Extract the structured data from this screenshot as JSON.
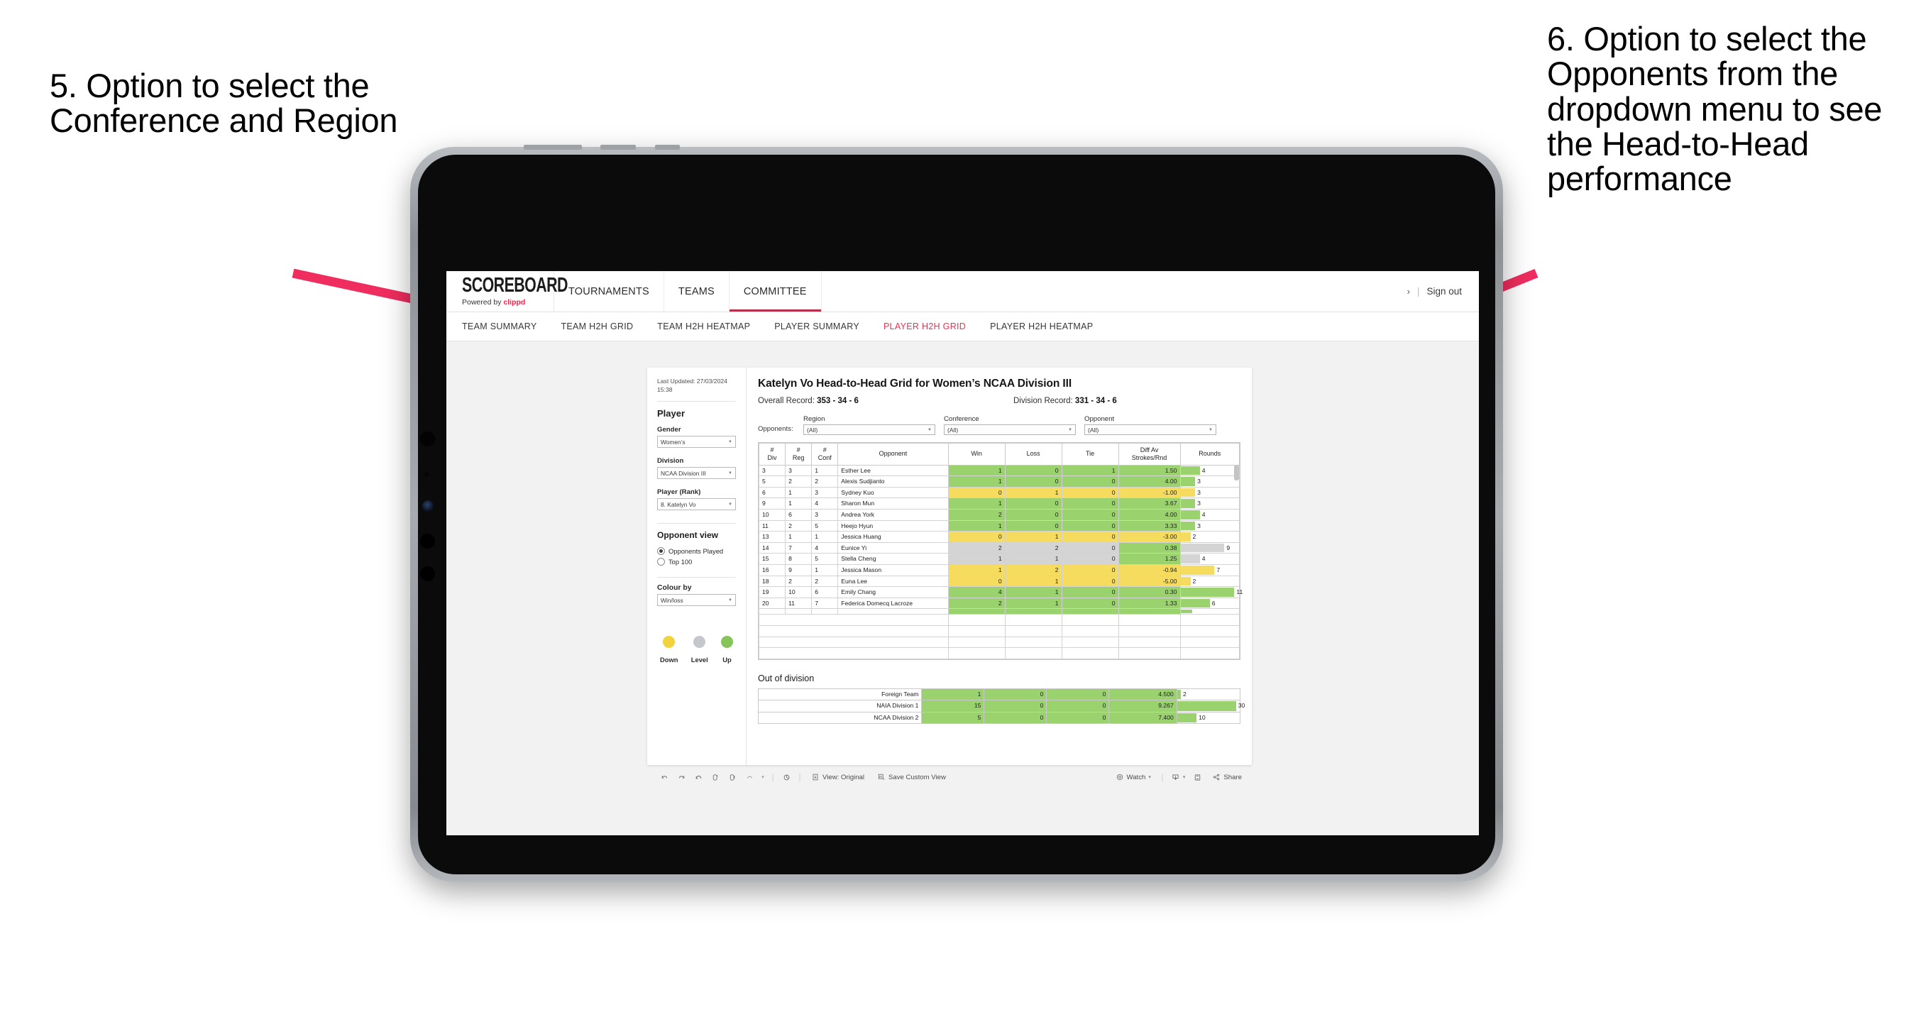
{
  "annotations": {
    "left": "5. Option to select the Conference and Region",
    "right": "6. Option to select the Opponents from the dropdown menu to see the Head-to-Head performance",
    "arrow_color": "#ef2d5e"
  },
  "topnav": {
    "logo_word": "SCOREBOARD",
    "logo_sub_prefix": "Powered by ",
    "logo_sub_brand": "clippd",
    "items": [
      {
        "label": "TOURNAMENTS",
        "active": false
      },
      {
        "label": "TEAMS",
        "active": false
      },
      {
        "label": "COMMITTEE",
        "active": true
      }
    ],
    "chevron": "›",
    "divider": "|",
    "signout": "Sign out"
  },
  "subnav": {
    "items": [
      {
        "label": "TEAM SUMMARY",
        "active": false
      },
      {
        "label": "TEAM H2H GRID",
        "active": false
      },
      {
        "label": "TEAM H2H HEATMAP",
        "active": false
      },
      {
        "label": "PLAYER SUMMARY",
        "active": false
      },
      {
        "label": "PLAYER H2H GRID",
        "active": true
      },
      {
        "label": "PLAYER H2H HEATMAP",
        "active": false
      }
    ]
  },
  "side_panel": {
    "last_updated": "Last Updated: 27/03/2024 15:38",
    "player_heading": "Player",
    "gender_label": "Gender",
    "gender_value": "Women’s",
    "division_label": "Division",
    "division_value": "NCAA Division III",
    "player_rank_label": "Player (Rank)",
    "player_rank_value": "8. Katelyn Vo",
    "opponent_view_heading": "Opponent view",
    "opponent_view_options": [
      {
        "label": "Opponents Played",
        "selected": true
      },
      {
        "label": "Top 100",
        "selected": false
      }
    ],
    "colour_by_label": "Colour by",
    "colour_by_value": "Win/loss",
    "legend": [
      {
        "label": "Down",
        "color": "#f2d33c"
      },
      {
        "label": "Level",
        "color": "#c4c8cc"
      },
      {
        "label": "Up",
        "color": "#85c55a"
      }
    ]
  },
  "main": {
    "title": "Katelyn Vo Head-to-Head Grid for Women’s NCAA Division III",
    "overall_record_label": "Overall Record: ",
    "overall_record_value": "353 - 34 - 6",
    "division_record_label": "Division Record: ",
    "division_record_value": "331 -  34 - 6",
    "opponents_label": "Opponents:",
    "filters": [
      {
        "label": "Region",
        "value": "(All)"
      },
      {
        "label": "Conference",
        "value": "(All)"
      },
      {
        "label": "Opponent",
        "value": "(All)"
      }
    ],
    "out_of_division_title": "Out of division"
  },
  "chart_data": {
    "type": "table",
    "title": "Katelyn Vo Head-to-Head Grid for Women’s NCAA Division III",
    "headers": [
      "# Div",
      "# Reg",
      "# Conf",
      "Opponent",
      "Win",
      "Loss",
      "Tie",
      "Diff Av Strokes/Rnd",
      "Rounds"
    ],
    "header_lines": [
      [
        "#",
        "Div"
      ],
      [
        "#",
        "Reg"
      ],
      [
        "#",
        "Conf"
      ],
      [
        "Opponent"
      ],
      [
        "Win"
      ],
      [
        "Loss"
      ],
      [
        "Tie"
      ],
      [
        "Diff Av",
        "Strokes/Rnd"
      ],
      [
        "Rounds"
      ]
    ],
    "rounds_max": 12,
    "rows": [
      {
        "div": "3",
        "reg": "3",
        "conf": "1",
        "opponent": "Esther Lee",
        "win": "1",
        "loss": "0",
        "tie": "1",
        "diff": "1.50",
        "rounds": 4,
        "state": "g"
      },
      {
        "div": "5",
        "reg": "2",
        "conf": "2",
        "opponent": "Alexis Sudjianto",
        "win": "1",
        "loss": "0",
        "tie": "0",
        "diff": "4.00",
        "rounds": 3,
        "state": "g"
      },
      {
        "div": "6",
        "reg": "1",
        "conf": "3",
        "opponent": "Sydney Kuo",
        "win": "0",
        "loss": "1",
        "tie": "0",
        "diff": "-1.00",
        "rounds": 3,
        "state": "y"
      },
      {
        "div": "9",
        "reg": "1",
        "conf": "4",
        "opponent": "Sharon Mun",
        "win": "1",
        "loss": "0",
        "tie": "0",
        "diff": "3.67",
        "rounds": 3,
        "state": "g"
      },
      {
        "div": "10",
        "reg": "6",
        "conf": "3",
        "opponent": "Andrea York",
        "win": "2",
        "loss": "0",
        "tie": "0",
        "diff": "4.00",
        "rounds": 4,
        "state": "g"
      },
      {
        "div": "11",
        "reg": "2",
        "conf": "5",
        "opponent": "Heejo Hyun",
        "win": "1",
        "loss": "0",
        "tie": "0",
        "diff": "3.33",
        "rounds": 3,
        "state": "g"
      },
      {
        "div": "13",
        "reg": "1",
        "conf": "1",
        "opponent": "Jessica Huang",
        "win": "0",
        "loss": "1",
        "tie": "0",
        "diff": "-3.00",
        "rounds": 2,
        "state": "y"
      },
      {
        "div": "14",
        "reg": "7",
        "conf": "4",
        "opponent": "Eunice Yi",
        "win": "2",
        "loss": "2",
        "tie": "0",
        "diff": "0.38",
        "rounds": 9,
        "state": "n",
        "diff_state": "g"
      },
      {
        "div": "15",
        "reg": "8",
        "conf": "5",
        "opponent": "Stella Cheng",
        "win": "1",
        "loss": "1",
        "tie": "0",
        "diff": "1.25",
        "rounds": 4,
        "state": "n",
        "diff_state": "g"
      },
      {
        "div": "16",
        "reg": "9",
        "conf": "1",
        "opponent": "Jessica Mason",
        "win": "1",
        "loss": "2",
        "tie": "0",
        "diff": "-0.94",
        "rounds": 7,
        "state": "y"
      },
      {
        "div": "18",
        "reg": "2",
        "conf": "2",
        "opponent": "Euna Lee",
        "win": "0",
        "loss": "1",
        "tie": "0",
        "diff": "-5.00",
        "rounds": 2,
        "state": "y"
      },
      {
        "div": "19",
        "reg": "10",
        "conf": "6",
        "opponent": "Emily Chang",
        "win": "4",
        "loss": "1",
        "tie": "0",
        "diff": "0.30",
        "rounds": 11,
        "state": "g"
      },
      {
        "div": "20",
        "reg": "11",
        "conf": "7",
        "opponent": "Federica Domecq Lacroze",
        "win": "2",
        "loss": "1",
        "tie": "0",
        "diff": "1.33",
        "rounds": 6,
        "state": "g"
      }
    ],
    "out_of_division": {
      "rounds_max": 32,
      "rows": [
        {
          "name": "Foreign Team",
          "win": "1",
          "loss": "0",
          "tie": "0",
          "diff": "4.500",
          "rounds": 2,
          "state": "g"
        },
        {
          "name": "NAIA Division 1",
          "win": "15",
          "loss": "0",
          "tie": "0",
          "diff": "9.267",
          "rounds": 30,
          "state": "g"
        },
        {
          "name": "NCAA Division 2",
          "win": "5",
          "loss": "0",
          "tie": "0",
          "diff": "7.400",
          "rounds": 10,
          "state": "g"
        }
      ]
    }
  },
  "toolbar": {
    "view_label": "View: Original",
    "save_label": "Save Custom View",
    "watch_label": "Watch",
    "share_label": "Share",
    "caret": "▾",
    "sep": "|"
  }
}
